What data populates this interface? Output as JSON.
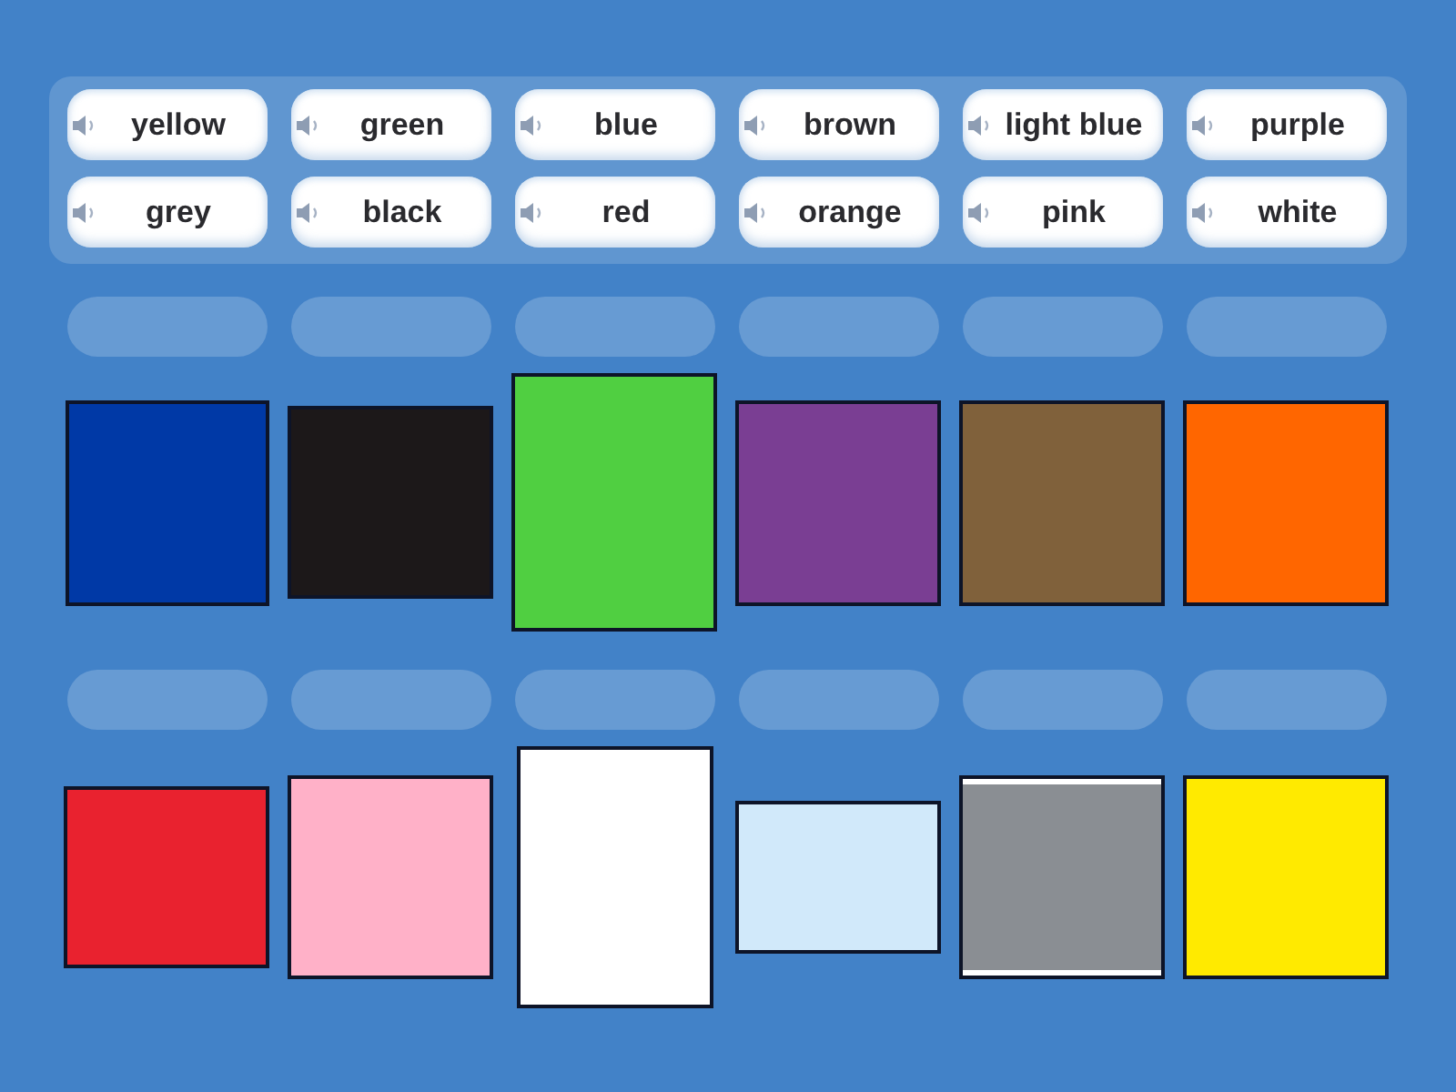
{
  "word_bank": {
    "tiles": [
      {
        "label": "yellow"
      },
      {
        "label": "green"
      },
      {
        "label": "blue"
      },
      {
        "label": "brown"
      },
      {
        "label": "light blue"
      },
      {
        "label": "purple"
      },
      {
        "label": "grey"
      },
      {
        "label": "black"
      },
      {
        "label": "red"
      },
      {
        "label": "orange"
      },
      {
        "label": "pink"
      },
      {
        "label": "white"
      }
    ]
  },
  "rows": [
    {
      "targets": [
        {
          "color": "#0039a6"
        },
        {
          "color": "#1c1819"
        },
        {
          "color": "#50cf41"
        },
        {
          "color": "#7a3e93"
        },
        {
          "color": "#80613b"
        },
        {
          "color": "#ff6600"
        }
      ]
    },
    {
      "targets": [
        {
          "color": "#e9222f"
        },
        {
          "color": "#ffb1c8"
        },
        {
          "color": "#ffffff"
        },
        {
          "color": "#d1e9fa"
        },
        {
          "color": "#8a8e93"
        },
        {
          "color": "#ffea00"
        }
      ]
    }
  ]
}
